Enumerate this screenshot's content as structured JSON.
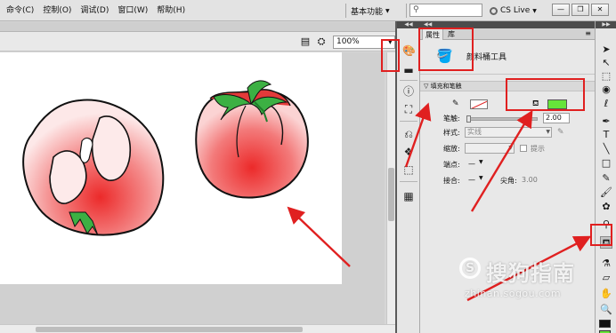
{
  "menubar": {
    "items": [
      "命令(C)",
      "控制(O)",
      "调试(D)",
      "窗口(W)",
      "帮助(H)"
    ],
    "workspace_label": "基本功能",
    "workspace_arrow": "▼",
    "search_icon": "search-icon",
    "cslive_label": "CS Live",
    "window_buttons": [
      "—",
      "❐",
      "✕"
    ]
  },
  "stage": {
    "zoom_value": "100%",
    "edit_icons": [
      "edit-symbols-icon",
      "edit-scene-icon"
    ]
  },
  "panel": {
    "tabs": [
      "属性",
      "库"
    ],
    "tool_name": "颜料桶工具",
    "section_title": "填充和笔触",
    "stroke_color": "#ffffff",
    "fill_color": "#66e43a",
    "stroke_width_label": "笔触:",
    "stroke_width_value": "2.00",
    "style_label": "样式:",
    "style_value": "实线",
    "scale_label": "缩放:",
    "hint_label": "提示",
    "cap_label": "端点:",
    "join_label": "接合:",
    "miter_label": "尖角:",
    "miter_value": "3.00",
    "dash": "—"
  },
  "toolbar": {
    "tools": [
      "selection-tool",
      "subselection-tool",
      "free-transform-tool",
      "3d-rotation-tool",
      "lasso-tool",
      "pen-tool",
      "text-tool",
      "line-tool",
      "rectangle-tool",
      "pencil-tool",
      "brush-tool",
      "deco-tool",
      "bone-tool",
      "paint-bucket-tool",
      "eyedropper-tool",
      "eraser-tool",
      "hand-tool",
      "zoom-tool",
      "stroke-color-tool",
      "fill-color-tool"
    ],
    "active_tool": "paint-bucket-tool"
  },
  "colors": {
    "annotation": "#e02020",
    "fill_green": "#66e43a",
    "tomato_red": "#ec2a2a",
    "leaf_green": "#3cb043"
  },
  "watermark": {
    "logo_letter": "S",
    "title": "搜狗指南",
    "url": "zhinan.sogou.com"
  }
}
